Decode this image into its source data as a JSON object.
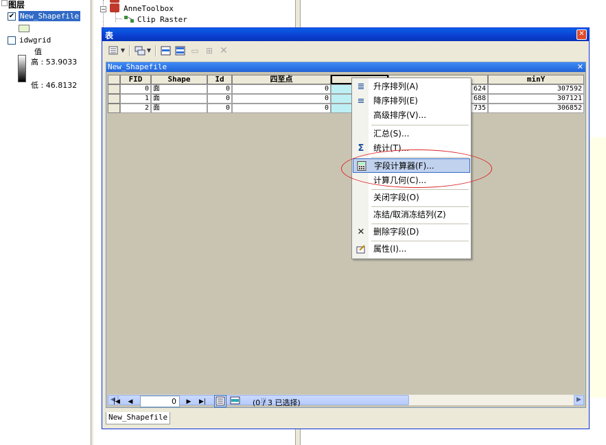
{
  "toc": {
    "root_label": "图层",
    "layers": [
      {
        "name": "New_Shapefile",
        "checked": "✔"
      },
      {
        "name": "idwgrid",
        "checked": ""
      }
    ],
    "ramp": {
      "title": "值",
      "high": "高 : 53.9033",
      "low": "低 : 46.8132"
    }
  },
  "toolbox": {
    "items": [
      {
        "label": "AnneToolbox"
      },
      {
        "label": "Clip Raster"
      }
    ]
  },
  "window": {
    "title": "表",
    "close": "✕",
    "toolbar_icons": [
      "table-options-icon",
      "related-tables-icon",
      "select-by-attributes-icon",
      "switch-selection-icon",
      "clear-selection-icon",
      "zoom-to-selected-icon",
      "delete-selected-icon"
    ],
    "subwindow": {
      "title": "New_Shapefile",
      "close": "✕",
      "columns": [
        "FID",
        "Shape",
        "Id",
        "四至点",
        "",
        "",
        "minY"
      ],
      "rows": [
        {
          "fid": "0",
          "shape": "面",
          "id": "0",
          "sizhi": "0",
          "partial": "624",
          "miny": "307592"
        },
        {
          "fid": "1",
          "shape": "面",
          "id": "0",
          "sizhi": "0",
          "partial": "688",
          "miny": "307121"
        },
        {
          "fid": "2",
          "shape": "面",
          "id": "0",
          "sizhi": "0",
          "partial": "735",
          "miny": "306852"
        }
      ]
    },
    "nav": {
      "current_record": "0",
      "status": "(0 / 3 已选择)"
    },
    "tab_label": "New_Shapefile"
  },
  "context_menu": {
    "items": [
      {
        "label": "升序排列(A)",
        "icon": "sort-ascending-icon"
      },
      {
        "label": "降序排列(E)",
        "icon": "sort-descending-icon"
      },
      {
        "label": "高级排序(V)...",
        "icon": ""
      },
      {
        "label": "汇总(S)...",
        "icon": ""
      },
      {
        "label": "统计(T)...",
        "icon": "sigma-icon"
      },
      {
        "label": "字段计算器(F)...",
        "icon": "calculator-icon"
      },
      {
        "label": "计算几何(C)...",
        "icon": ""
      },
      {
        "label": "关闭字段(O)",
        "icon": ""
      },
      {
        "label": "冻结/取消冻结列(Z)",
        "icon": ""
      },
      {
        "label": "删除字段(D)",
        "icon": "delete-icon"
      },
      {
        "label": "属性(I)...",
        "icon": "properties-icon"
      }
    ],
    "highlighted_item": "字段计算器(F)..."
  },
  "colors": {
    "title_blue": "#0a5fe8",
    "highlight": "#c1d2ee",
    "selected_column": "#bdf0f5",
    "annotation_red": "#dd2222"
  }
}
